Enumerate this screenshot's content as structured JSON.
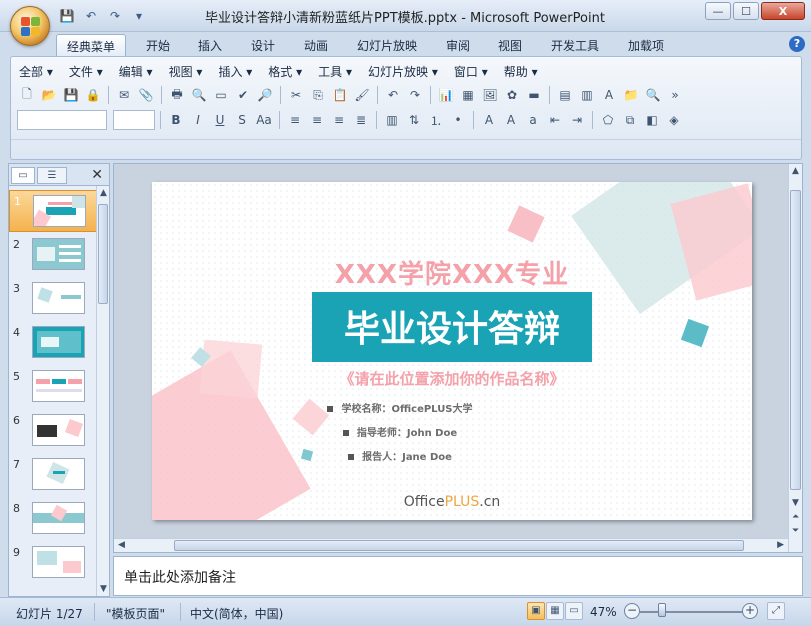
{
  "window": {
    "title": "毕业设计答辩小清新粉蓝纸片PPT模板.pptx - Microsoft PowerPoint",
    "controls": {
      "minimize": "—",
      "maximize": "☐",
      "close": "X"
    }
  },
  "ribbon_tabs": [
    "经典菜单",
    "开始",
    "插入",
    "设计",
    "动画",
    "幻灯片放映",
    "审阅",
    "视图",
    "开发工具",
    "加载项"
  ],
  "active_tab": "经典菜单",
  "classic_menu": [
    "全部",
    "文件",
    "编辑",
    "视图",
    "插入",
    "格式",
    "工具",
    "幻灯片放映",
    "窗口",
    "帮助"
  ],
  "thumbnails": [
    {
      "num": "1",
      "selected": true
    },
    {
      "num": "2"
    },
    {
      "num": "3"
    },
    {
      "num": "4"
    },
    {
      "num": "5"
    },
    {
      "num": "6"
    },
    {
      "num": "7"
    },
    {
      "num": "8"
    },
    {
      "num": "9"
    }
  ],
  "slide": {
    "subtitle": "XXX学院XXX专业",
    "title": "毕业设计答辩",
    "work_name": "《请在此位置添加你的作品名称》",
    "school": "学校名称：OfficePLUS大学",
    "advisor": "指导老师：John Doe",
    "reporter": "报告人：Jane Doe",
    "brand_prefix": "Office",
    "brand_plus": "PLUS",
    "brand_suffix": ".cn",
    "colors": {
      "pink": "#f4a1aa",
      "teal": "#1aa3b5"
    }
  },
  "notes": {
    "placeholder": "单击此处添加备注"
  },
  "status": {
    "slide_counter": "幻灯片 1/27",
    "theme": "\"模板页面\"",
    "language": "中文(简体，中国)",
    "zoom": "47%"
  }
}
